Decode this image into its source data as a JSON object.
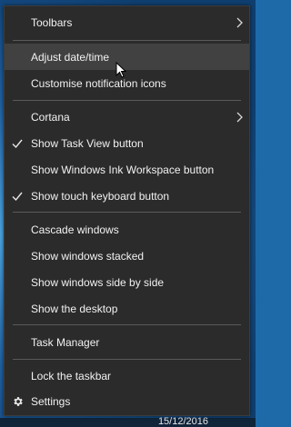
{
  "menu": {
    "toolbars": "Toolbars",
    "adjust_datetime": "Adjust date/time",
    "customise_notification_icons": "Customise notification icons",
    "cortana": "Cortana",
    "show_task_view": "Show Task View button",
    "show_ink_workspace": "Show Windows Ink Workspace button",
    "show_touch_keyboard": "Show touch keyboard button",
    "cascade_windows": "Cascade windows",
    "show_windows_stacked": "Show windows stacked",
    "show_windows_side_by_side": "Show windows side by side",
    "show_desktop": "Show the desktop",
    "task_manager": "Task Manager",
    "lock_taskbar": "Lock the taskbar",
    "settings": "Settings"
  },
  "checked_items": [
    "Show Task View button",
    "Show touch keyboard button"
  ],
  "taskbar": {
    "date": "15/12/2016"
  },
  "colors": {
    "menu_bg": "#2b2b2b",
    "hover_bg": "#414141",
    "text": "#f2f2f2",
    "separator": "#5a5a5a"
  }
}
